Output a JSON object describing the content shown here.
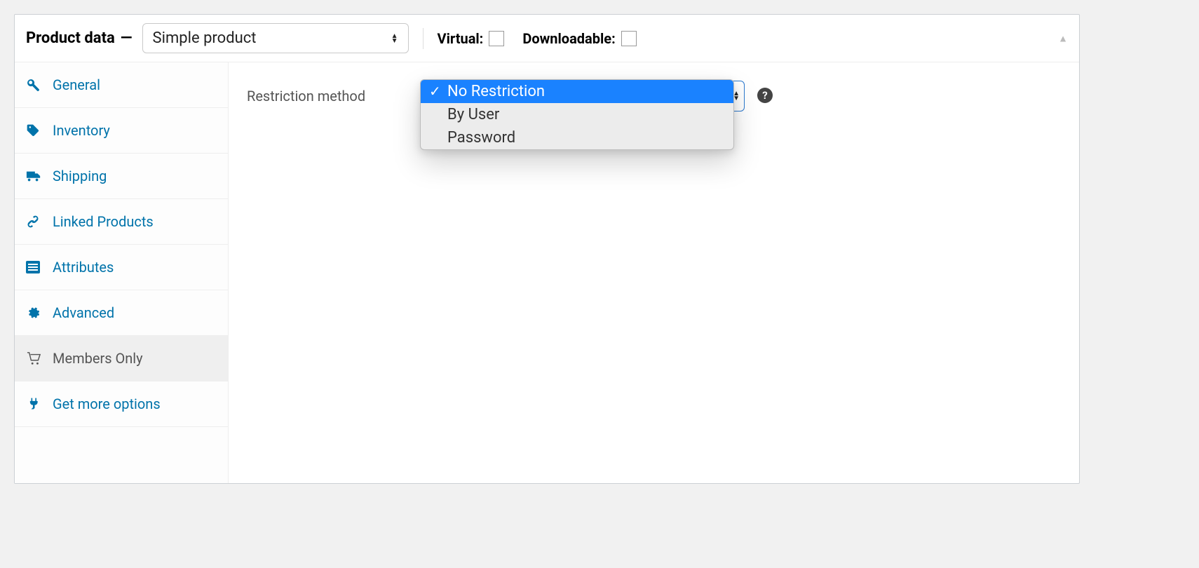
{
  "header": {
    "title": "Product data",
    "product_type": "Simple product",
    "virtual_label": "Virtual:",
    "downloadable_label": "Downloadable:"
  },
  "tabs": [
    {
      "label": "General",
      "icon": "wrench-icon"
    },
    {
      "label": "Inventory",
      "icon": "tag-icon"
    },
    {
      "label": "Shipping",
      "icon": "truck-icon"
    },
    {
      "label": "Linked Products",
      "icon": "link-icon"
    },
    {
      "label": "Attributes",
      "icon": "list-icon"
    },
    {
      "label": "Advanced",
      "icon": "gear-icon"
    },
    {
      "label": "Members Only",
      "icon": "cart-icon",
      "active": true
    },
    {
      "label": "Get more options",
      "icon": "plug-icon"
    }
  ],
  "content": {
    "restriction_label": "Restriction method",
    "options": [
      "No Restriction",
      "By User",
      "Password"
    ],
    "selected": "No Restriction"
  }
}
